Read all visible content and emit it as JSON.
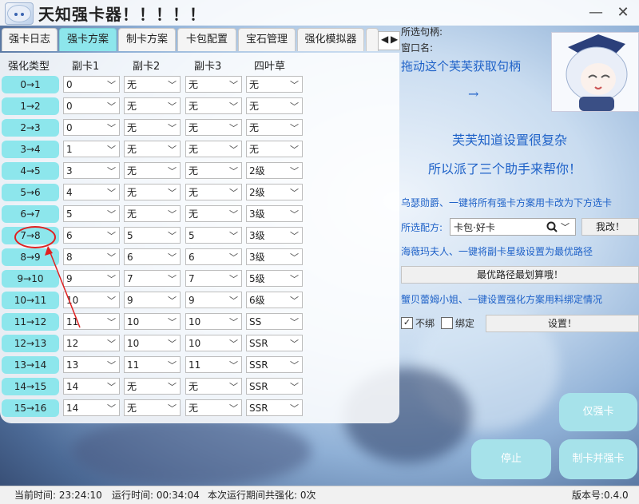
{
  "window": {
    "title": "天知强卡器！！！！！",
    "minimize": "—",
    "close": "✕"
  },
  "tabs": [
    {
      "label": "强卡日志"
    },
    {
      "label": "强卡方案"
    },
    {
      "label": "制卡方案"
    },
    {
      "label": "卡包配置"
    },
    {
      "label": "宝石管理"
    },
    {
      "label": "强化模拟器"
    }
  ],
  "tab_scroll": {
    "left": "◀",
    "right": "▶"
  },
  "table": {
    "headers": [
      "强化类型",
      "副卡1",
      "副卡2",
      "副卡3",
      "四叶草"
    ],
    "rows": [
      {
        "type": "0→1",
        "c1": "0",
        "c2": "无",
        "c3": "无",
        "clover": "无"
      },
      {
        "type": "1→2",
        "c1": "0",
        "c2": "无",
        "c3": "无",
        "clover": "无"
      },
      {
        "type": "2→3",
        "c1": "0",
        "c2": "无",
        "c3": "无",
        "clover": "无"
      },
      {
        "type": "3→4",
        "c1": "1",
        "c2": "无",
        "c3": "无",
        "clover": "无"
      },
      {
        "type": "4→5",
        "c1": "3",
        "c2": "无",
        "c3": "无",
        "clover": "2级"
      },
      {
        "type": "5→6",
        "c1": "4",
        "c2": "无",
        "c3": "无",
        "clover": "2级"
      },
      {
        "type": "6→7",
        "c1": "5",
        "c2": "无",
        "c3": "无",
        "clover": "3级"
      },
      {
        "type": "7→8",
        "c1": "6",
        "c2": "5",
        "c3": "5",
        "clover": "3级"
      },
      {
        "type": "8→9",
        "c1": "8",
        "c2": "6",
        "c3": "6",
        "clover": "3级"
      },
      {
        "type": "9→10",
        "c1": "9",
        "c2": "7",
        "c3": "7",
        "clover": "5级"
      },
      {
        "type": "10→11",
        "c1": "10",
        "c2": "9",
        "c3": "9",
        "clover": "6级"
      },
      {
        "type": "11→12",
        "c1": "11",
        "c2": "10",
        "c3": "10",
        "clover": "SS"
      },
      {
        "type": "12→13",
        "c1": "12",
        "c2": "10",
        "c3": "10",
        "clover": "SSR"
      },
      {
        "type": "13→14",
        "c1": "13",
        "c2": "11",
        "c3": "11",
        "clover": "SSR"
      },
      {
        "type": "14→15",
        "c1": "14",
        "c2": "无",
        "c3": "无",
        "clover": "SSR"
      },
      {
        "type": "15→16",
        "c1": "14",
        "c2": "无",
        "c3": "无",
        "clover": "SSR"
      }
    ]
  },
  "right": {
    "handle_label": "所选句柄:",
    "window_name_label": "窗口名:",
    "drag_hint": "拖动这个芙芙获取句柄",
    "arrow": "→",
    "line1": "芙芙知道设置很复杂",
    "line2": "所以派了三个助手来帮你！",
    "assistant1": "乌瑟勋爵、一键将所有强卡方案用卡改为下方选卡",
    "recipe_label": "所选配方:",
    "recipe_value": "卡包·好卡",
    "change_btn": "我改！",
    "assistant2": "海薇玛夫人、一键将副卡星级设置为最优路径",
    "optimal_btn": "最优路径最划算哦！",
    "assistant3": "蟹贝蕾姆小姐、一键设置强化方案用料绑定情况",
    "unbound_label": "不绑",
    "bound_label": "绑定",
    "setup_btn": "设置！"
  },
  "actions": {
    "enhance_only": "仅强卡",
    "stop": "停止",
    "make_and_enhance": "制卡并强卡"
  },
  "status": {
    "current_time": "当前时间: 23:24:10",
    "run_time": "运行时间: 00:34:04",
    "session_count": "本次运行期间共强化: 0次",
    "version": "版本号:0.4.0"
  },
  "colors": {
    "accent": "#8de6ec",
    "blue_text": "#1f62c8",
    "highlight": "#e02020"
  },
  "icons": {
    "search": "search-icon",
    "dropdown": "chevron-down-icon"
  }
}
